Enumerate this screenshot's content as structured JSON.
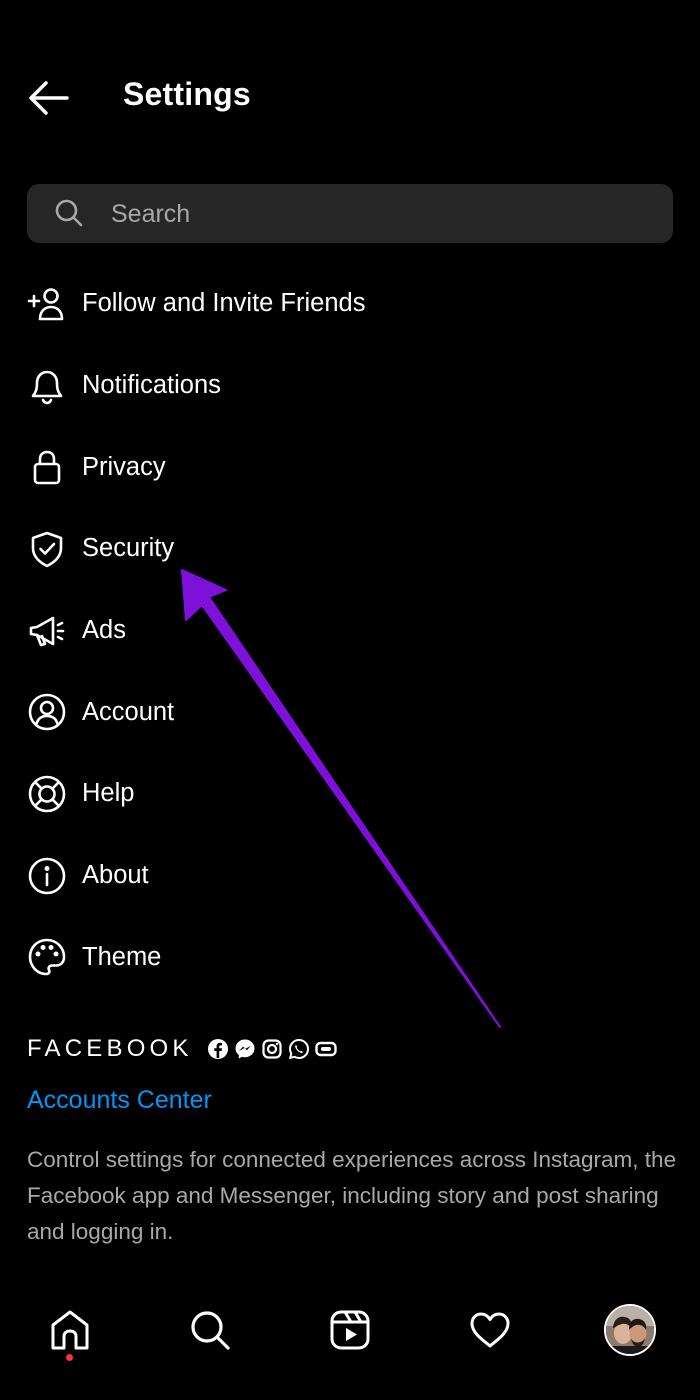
{
  "header": {
    "title": "Settings"
  },
  "search": {
    "placeholder": "Search",
    "value": ""
  },
  "menu": {
    "items": [
      {
        "label": "Follow and Invite Friends",
        "icon": "add-person-icon"
      },
      {
        "label": "Notifications",
        "icon": "bell-icon"
      },
      {
        "label": "Privacy",
        "icon": "lock-icon"
      },
      {
        "label": "Security",
        "icon": "shield-check-icon"
      },
      {
        "label": "Ads",
        "icon": "megaphone-icon"
      },
      {
        "label": "Account",
        "icon": "account-circle-icon"
      },
      {
        "label": "Help",
        "icon": "lifebuoy-icon"
      },
      {
        "label": "About",
        "icon": "info-icon"
      },
      {
        "label": "Theme",
        "icon": "palette-icon"
      }
    ]
  },
  "facebook": {
    "brand": "FACEBOOK",
    "app_icons": [
      "facebook-icon",
      "messenger-icon",
      "instagram-icon",
      "whatsapp-icon",
      "portal-icon"
    ],
    "accounts_center": {
      "label": "Accounts Center",
      "description": "Control settings for connected experiences across Instagram, the Facebook app and Messenger, including story and post sharing and logging in."
    }
  },
  "bottom_nav": {
    "items": [
      "home-icon",
      "search-icon",
      "reels-icon",
      "heart-icon",
      "profile-avatar"
    ],
    "active": "home-icon"
  },
  "colors": {
    "background": "#000000",
    "search_bg": "#262626",
    "link": "#0095f6",
    "secondary_text": "#a8a8a8",
    "annotation_arrow": "#7d10d9",
    "notification_dot": "#ff3040"
  }
}
